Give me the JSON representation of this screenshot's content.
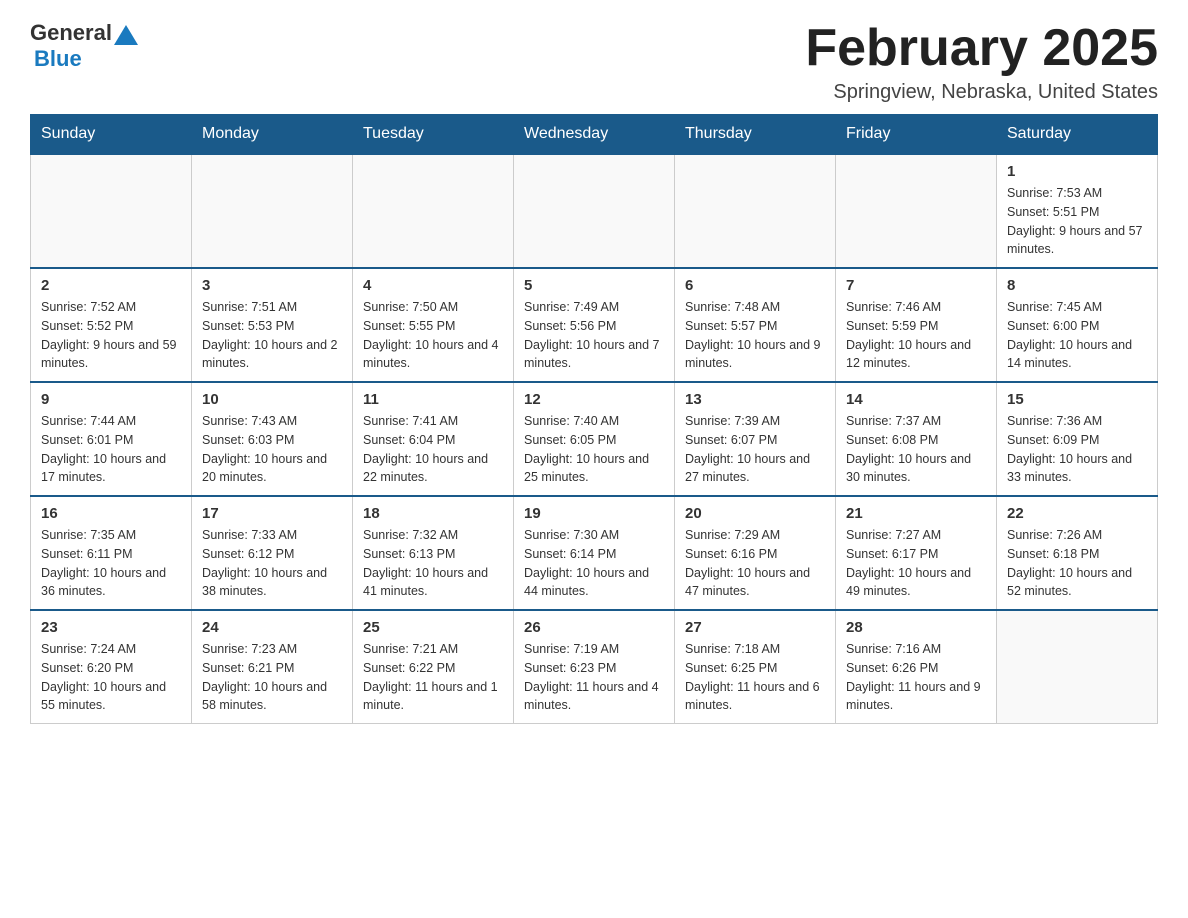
{
  "logo": {
    "text1": "General",
    "text2": "Blue"
  },
  "header": {
    "month": "February 2025",
    "location": "Springview, Nebraska, United States"
  },
  "days_of_week": [
    "Sunday",
    "Monday",
    "Tuesday",
    "Wednesday",
    "Thursday",
    "Friday",
    "Saturday"
  ],
  "weeks": [
    [
      {
        "day": "",
        "info": ""
      },
      {
        "day": "",
        "info": ""
      },
      {
        "day": "",
        "info": ""
      },
      {
        "day": "",
        "info": ""
      },
      {
        "day": "",
        "info": ""
      },
      {
        "day": "",
        "info": ""
      },
      {
        "day": "1",
        "info": "Sunrise: 7:53 AM\nSunset: 5:51 PM\nDaylight: 9 hours and 57 minutes."
      }
    ],
    [
      {
        "day": "2",
        "info": "Sunrise: 7:52 AM\nSunset: 5:52 PM\nDaylight: 9 hours and 59 minutes."
      },
      {
        "day": "3",
        "info": "Sunrise: 7:51 AM\nSunset: 5:53 PM\nDaylight: 10 hours and 2 minutes."
      },
      {
        "day": "4",
        "info": "Sunrise: 7:50 AM\nSunset: 5:55 PM\nDaylight: 10 hours and 4 minutes."
      },
      {
        "day": "5",
        "info": "Sunrise: 7:49 AM\nSunset: 5:56 PM\nDaylight: 10 hours and 7 minutes."
      },
      {
        "day": "6",
        "info": "Sunrise: 7:48 AM\nSunset: 5:57 PM\nDaylight: 10 hours and 9 minutes."
      },
      {
        "day": "7",
        "info": "Sunrise: 7:46 AM\nSunset: 5:59 PM\nDaylight: 10 hours and 12 minutes."
      },
      {
        "day": "8",
        "info": "Sunrise: 7:45 AM\nSunset: 6:00 PM\nDaylight: 10 hours and 14 minutes."
      }
    ],
    [
      {
        "day": "9",
        "info": "Sunrise: 7:44 AM\nSunset: 6:01 PM\nDaylight: 10 hours and 17 minutes."
      },
      {
        "day": "10",
        "info": "Sunrise: 7:43 AM\nSunset: 6:03 PM\nDaylight: 10 hours and 20 minutes."
      },
      {
        "day": "11",
        "info": "Sunrise: 7:41 AM\nSunset: 6:04 PM\nDaylight: 10 hours and 22 minutes."
      },
      {
        "day": "12",
        "info": "Sunrise: 7:40 AM\nSunset: 6:05 PM\nDaylight: 10 hours and 25 minutes."
      },
      {
        "day": "13",
        "info": "Sunrise: 7:39 AM\nSunset: 6:07 PM\nDaylight: 10 hours and 27 minutes."
      },
      {
        "day": "14",
        "info": "Sunrise: 7:37 AM\nSunset: 6:08 PM\nDaylight: 10 hours and 30 minutes."
      },
      {
        "day": "15",
        "info": "Sunrise: 7:36 AM\nSunset: 6:09 PM\nDaylight: 10 hours and 33 minutes."
      }
    ],
    [
      {
        "day": "16",
        "info": "Sunrise: 7:35 AM\nSunset: 6:11 PM\nDaylight: 10 hours and 36 minutes."
      },
      {
        "day": "17",
        "info": "Sunrise: 7:33 AM\nSunset: 6:12 PM\nDaylight: 10 hours and 38 minutes."
      },
      {
        "day": "18",
        "info": "Sunrise: 7:32 AM\nSunset: 6:13 PM\nDaylight: 10 hours and 41 minutes."
      },
      {
        "day": "19",
        "info": "Sunrise: 7:30 AM\nSunset: 6:14 PM\nDaylight: 10 hours and 44 minutes."
      },
      {
        "day": "20",
        "info": "Sunrise: 7:29 AM\nSunset: 6:16 PM\nDaylight: 10 hours and 47 minutes."
      },
      {
        "day": "21",
        "info": "Sunrise: 7:27 AM\nSunset: 6:17 PM\nDaylight: 10 hours and 49 minutes."
      },
      {
        "day": "22",
        "info": "Sunrise: 7:26 AM\nSunset: 6:18 PM\nDaylight: 10 hours and 52 minutes."
      }
    ],
    [
      {
        "day": "23",
        "info": "Sunrise: 7:24 AM\nSunset: 6:20 PM\nDaylight: 10 hours and 55 minutes."
      },
      {
        "day": "24",
        "info": "Sunrise: 7:23 AM\nSunset: 6:21 PM\nDaylight: 10 hours and 58 minutes."
      },
      {
        "day": "25",
        "info": "Sunrise: 7:21 AM\nSunset: 6:22 PM\nDaylight: 11 hours and 1 minute."
      },
      {
        "day": "26",
        "info": "Sunrise: 7:19 AM\nSunset: 6:23 PM\nDaylight: 11 hours and 4 minutes."
      },
      {
        "day": "27",
        "info": "Sunrise: 7:18 AM\nSunset: 6:25 PM\nDaylight: 11 hours and 6 minutes."
      },
      {
        "day": "28",
        "info": "Sunrise: 7:16 AM\nSunset: 6:26 PM\nDaylight: 11 hours and 9 minutes."
      },
      {
        "day": "",
        "info": ""
      }
    ]
  ]
}
